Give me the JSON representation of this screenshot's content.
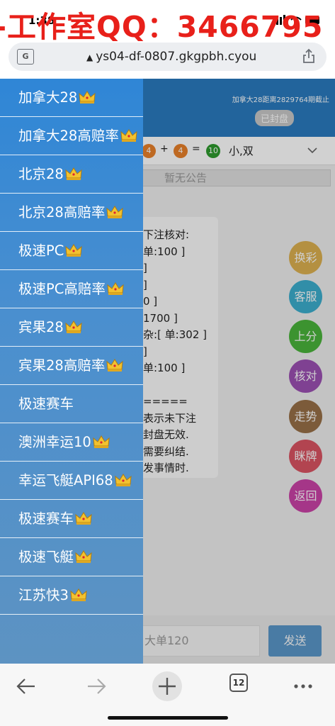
{
  "status": {
    "time": "1:38",
    "watermark": "-工作室QQ：3466795"
  },
  "address_bar": {
    "url": "ys04-df-0807.gkgpbh.cyou"
  },
  "page": {
    "header_info": "加拿大28距离2829764期截止",
    "status_pill": "已封盘",
    "result": {
      "ball1": "4",
      "plus": "+",
      "ball2": "4",
      "equals": "=",
      "ball3": "10",
      "text": "小,双"
    },
    "notice": "暂无公告",
    "message_lines": "下注核对:\n单:100 ]\n]\n]\n0 ]\n1700 ]\n杂:[ 单:302 ]\n]\n单:100 ]\n\n=====\n表示未下注\n封盘无效.\n需要纠结.\n发事情时.",
    "side_buttons": [
      {
        "label": "换彩",
        "color": "#d9a635"
      },
      {
        "label": "客服",
        "color": "#1ea3c9"
      },
      {
        "label": "上分",
        "color": "#2eaa1c"
      },
      {
        "label": "核对",
        "color": "#8d35a8"
      },
      {
        "label": "走势",
        "color": "#8a5a2a"
      },
      {
        "label": "眯牌",
        "color": "#d6384a"
      },
      {
        "label": "返回",
        "color": "#c4259a"
      }
    ],
    "input_placeholder": "大单120",
    "send_label": "发送"
  },
  "drawer": {
    "items": [
      {
        "label": "加拿大28",
        "crown": true
      },
      {
        "label": "加拿大28高赔率",
        "crown": true
      },
      {
        "label": "北京28",
        "crown": true
      },
      {
        "label": "北京28高赔率",
        "crown": true
      },
      {
        "label": "极速PC",
        "crown": true
      },
      {
        "label": "极速PC高赔率",
        "crown": true
      },
      {
        "label": "宾果28",
        "crown": true
      },
      {
        "label": "宾果28高赔率",
        "crown": true
      },
      {
        "label": "极速赛车",
        "crown": false
      },
      {
        "label": "澳洲幸运10",
        "crown": true
      },
      {
        "label": "幸运飞艇API68",
        "crown": true
      },
      {
        "label": "极速赛车",
        "crown": true
      },
      {
        "label": "极速飞艇",
        "crown": true
      },
      {
        "label": "江苏快3",
        "crown": true
      }
    ]
  },
  "bottom_nav": {
    "tab_count": "12"
  },
  "colors": {
    "header_blue": "#2a7bbf",
    "watermark_red": "#e8201a",
    "ball_orange": "#e8812a",
    "ball_green": "#2e9a2e"
  }
}
